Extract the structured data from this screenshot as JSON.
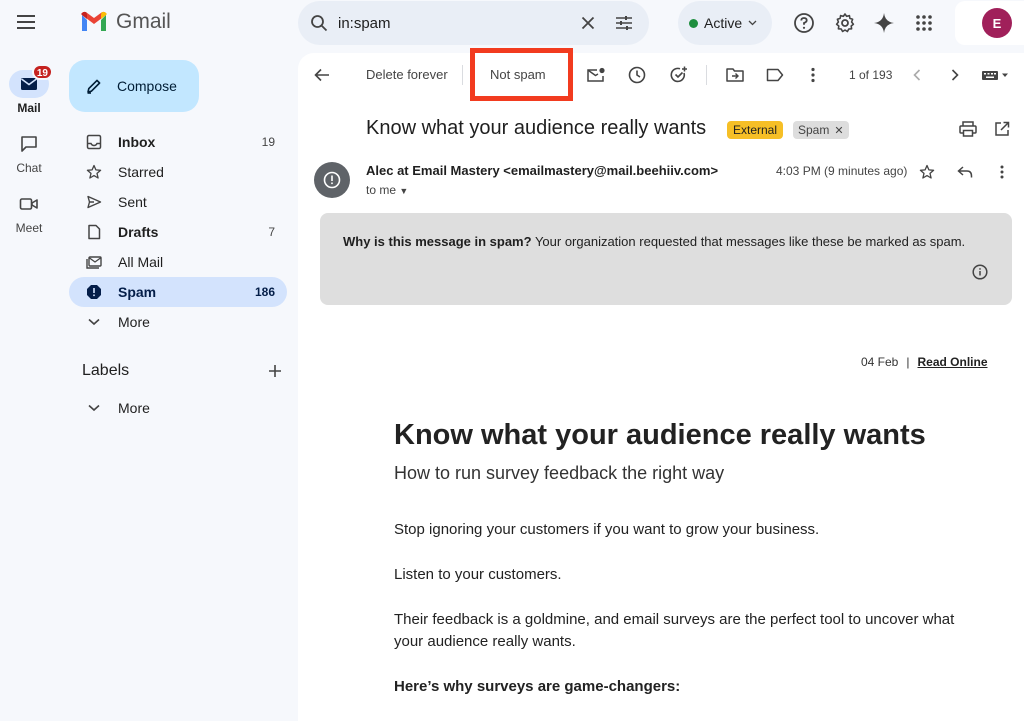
{
  "app": {
    "name": "Gmail"
  },
  "rail": {
    "items": [
      {
        "label": "Mail",
        "badge": "19"
      },
      {
        "label": "Chat"
      },
      {
        "label": "Meet"
      }
    ]
  },
  "compose": {
    "label": "Compose"
  },
  "nav": {
    "items": [
      {
        "label": "Inbox",
        "count": "19"
      },
      {
        "label": "Starred",
        "count": ""
      },
      {
        "label": "Sent",
        "count": ""
      },
      {
        "label": "Drafts",
        "count": "7"
      },
      {
        "label": "All Mail",
        "count": ""
      },
      {
        "label": "Spam",
        "count": "186"
      },
      {
        "label": "More",
        "count": ""
      }
    ]
  },
  "labels": {
    "title": "Labels",
    "more": "More"
  },
  "search": {
    "value": "in:spam"
  },
  "status": {
    "label": "Active"
  },
  "account": {
    "initial": "E"
  },
  "toolbar": {
    "delete_forever": "Delete forever",
    "not_spam": "Not spam",
    "pager": "1 of 193"
  },
  "message": {
    "subject": "Know what your audience really wants",
    "tag_external": "External",
    "tag_spam": "Spam",
    "sender": "Alec at Email Mastery <emailmastery@mail.beehiiv.com>",
    "to": "to me",
    "time": "4:03 PM (9 minutes ago)",
    "warning_bold": "Why is this message in spam?",
    "warning_text": " Your organization requested that messages like these be marked as spam."
  },
  "email": {
    "date": "04 Feb",
    "separator": "|",
    "read_online": "Read Online",
    "title": "Know what your audience really wants",
    "subtitle": "How to run survey feedback the right way",
    "p1": "Stop ignoring your customers if you want to grow your business.",
    "p2": "Listen to your customers.",
    "p3": "Their feedback is a goldmine, and email surveys are the perfect tool to uncover what your audience really wants.",
    "p4": "Here’s why surveys are game-changers:"
  },
  "colors": {
    "highlight_box": "#f23b1f",
    "external_tag": "#f6bf26",
    "active_dot": "#1e8e3e",
    "selected_nav": "#d3e3fd",
    "compose_bg": "#c2e7ff"
  }
}
